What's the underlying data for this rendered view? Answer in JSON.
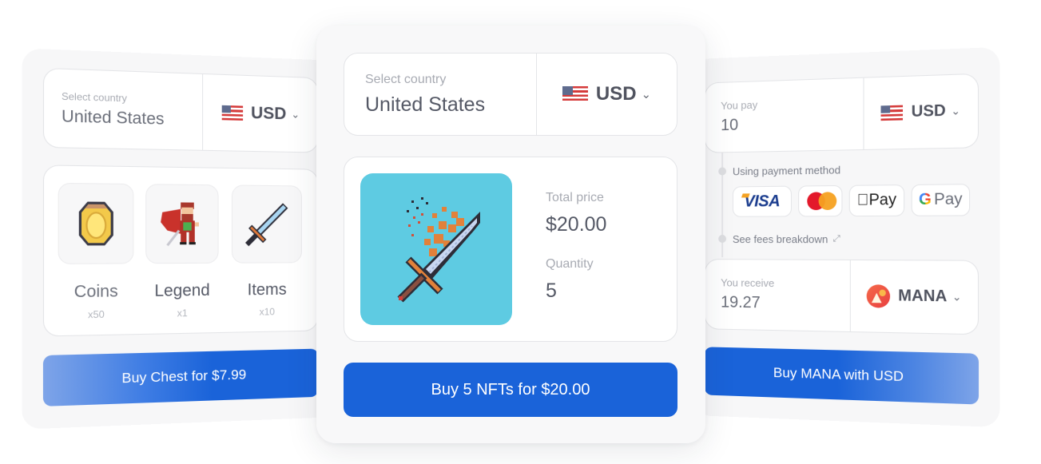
{
  "left_widget": {
    "country_label": "Select country",
    "country_value": "United States",
    "currency": "USD",
    "items": [
      {
        "name": "Coins",
        "qty": "x50",
        "icon": "coin-icon"
      },
      {
        "name": "Legend",
        "qty": "x1",
        "icon": "hero-icon"
      },
      {
        "name": "Items",
        "qty": "x10",
        "icon": "sword-icon"
      }
    ],
    "buy_button": "Buy Chest for $7.99"
  },
  "center_widget": {
    "country_label": "Select country",
    "country_value": "United States",
    "currency": "USD",
    "product_image": "flaming-sword-nft",
    "total_price_label": "Total price",
    "total_price_value": "$20.00",
    "quantity_label": "Quantity",
    "quantity_value": "5",
    "buy_button": "Buy 5 NFTs for $20.00",
    "accent_color": "#1a63d9"
  },
  "right_widget": {
    "pay_label": "You pay",
    "pay_value": "10",
    "pay_currency": "USD",
    "payment_method_label": "Using payment method",
    "payment_methods": [
      "VISA",
      "Mastercard",
      "Apple Pay",
      "Google Pay"
    ],
    "apple_pay_text": "Pay",
    "google_pay_text": "Pay",
    "fees_link": "See fees breakdown",
    "receive_label": "You receive",
    "receive_value": "19.27",
    "receive_currency": "MANA",
    "buy_button": "Buy MANA with USD"
  },
  "icons": {
    "chevron": "⌄",
    "expand": "⤢",
    "apple": ""
  }
}
